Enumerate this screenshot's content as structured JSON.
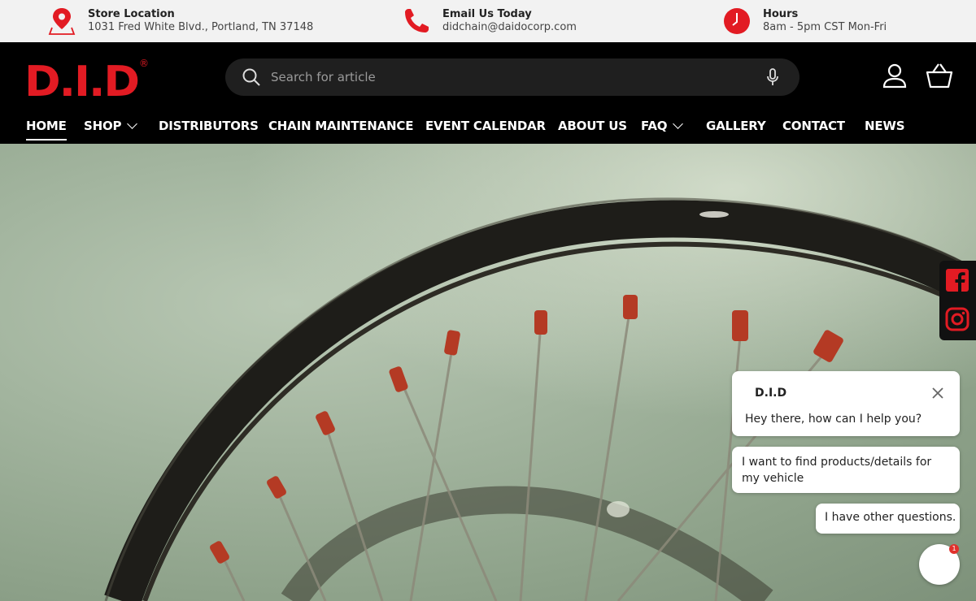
{
  "topbar": {
    "location": {
      "title": "Store Location",
      "text": "1031 Fred White Blvd., Portland, TN 37148"
    },
    "email": {
      "title": "Email Us Today",
      "text": "didchain@daidocorp.com"
    },
    "hours": {
      "title": "Hours",
      "text": "8am - 5pm CST Mon-Fri"
    }
  },
  "brand": {
    "logo_text": "D.I.D",
    "registered": "®",
    "color": "#e21b23"
  },
  "search": {
    "placeholder": "Search for article"
  },
  "nav": [
    {
      "label": "HOME",
      "active": true
    },
    {
      "label": "SHOP",
      "dropdown": true
    },
    {
      "label": "DISTRIBUTORS"
    },
    {
      "label": "CHAIN MAINTENANCE"
    },
    {
      "label": "EVENT CALENDAR"
    },
    {
      "label": "ABOUT US"
    },
    {
      "label": "FAQ",
      "dropdown": true
    },
    {
      "label": "GALLERY"
    },
    {
      "label": "CONTACT"
    },
    {
      "label": "NEWS"
    }
  ],
  "social": [
    "facebook-icon",
    "instagram-icon"
  ],
  "chat": {
    "brand": "D.I.D",
    "greeting": "Hey there, how can I help you?",
    "options": [
      "I want to find products/details for my vehicle",
      "I have other questions."
    ],
    "badge": "1"
  },
  "colors": {
    "accent": "#e21b23",
    "header_bg": "#000000",
    "topbar_bg": "#f2f2f2"
  }
}
